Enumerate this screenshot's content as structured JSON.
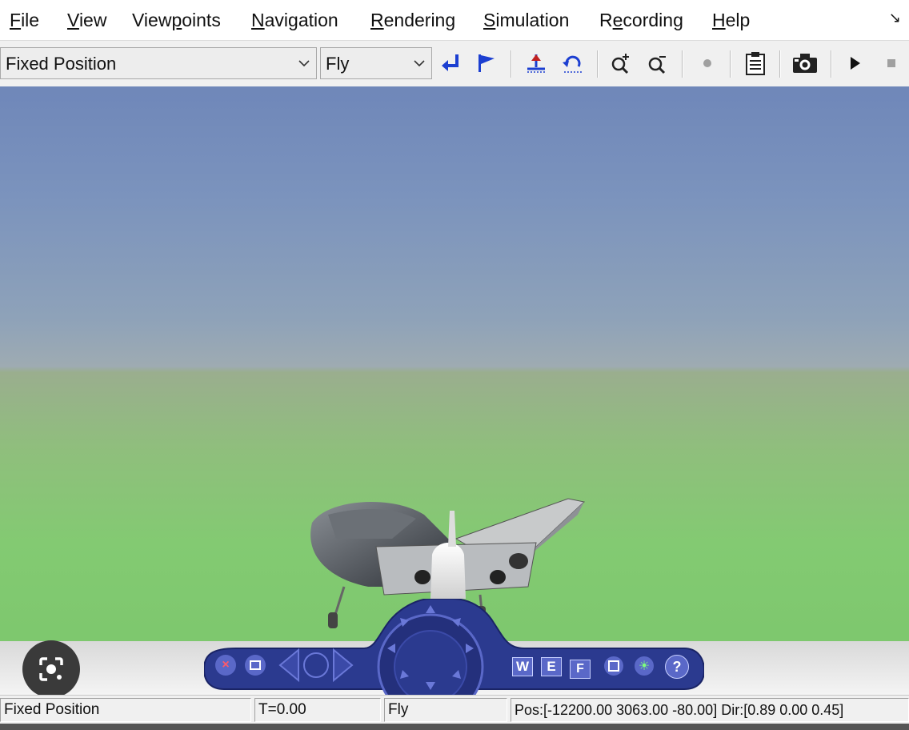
{
  "menu": {
    "items": [
      {
        "label": "File",
        "u": "F",
        "rest": "ile"
      },
      {
        "label": "View",
        "u": "V",
        "rest": "iew"
      },
      {
        "label": "Viewpoints",
        "pre": "View",
        "u": "p",
        "rest": "oints"
      },
      {
        "label": "Navigation",
        "u": "N",
        "rest": "avigation"
      },
      {
        "label": "Rendering",
        "u": "R",
        "rest": "endering"
      },
      {
        "label": "Simulation",
        "u": "S",
        "rest": "imulation"
      },
      {
        "label": "Recording",
        "pre": "R",
        "u": "e",
        "rest": "cording"
      },
      {
        "label": "Help",
        "u": "H",
        "rest": "elp"
      }
    ]
  },
  "toolbar": {
    "viewpoint_select": "Fixed Position",
    "navigation_select": "Fly"
  },
  "navpanel": {
    "w_label": "W",
    "e_label": "E",
    "f_label": "F",
    "help_label": "?"
  },
  "status": {
    "viewpoint": "Fixed Position",
    "time": "T=0.00",
    "mode": "Fly",
    "position": "Pos:[-12200.00 3063.00 -80.00] Dir:[0.89 0.00 0.45]"
  },
  "colors": {
    "nav_panel": "#2b3a8f",
    "nav_accent": "#5a68c8",
    "sky_top": "#6f87b9",
    "ground": "#7ec86e"
  }
}
